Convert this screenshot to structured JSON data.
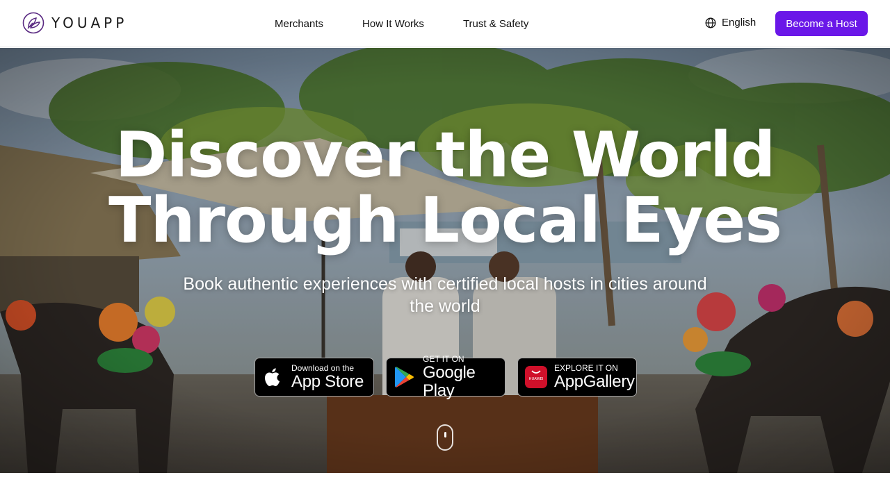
{
  "brand": {
    "name": "YOUAPP",
    "accent": "#6a17e8"
  },
  "nav": {
    "items": [
      {
        "label": "Merchants"
      },
      {
        "label": "How It Works"
      },
      {
        "label": "Trust & Safety"
      }
    ],
    "language": "English",
    "cta": "Become a Host"
  },
  "hero": {
    "line1": "Discover the World",
    "line2": "Through Local Eyes",
    "subtitle": "Book authentic experiences with certified local hosts in cities around the world"
  },
  "stores": {
    "apple": {
      "small": "Download on the",
      "big": "App Store",
      "icon": "apple-icon"
    },
    "google": {
      "small": "GET IT ON",
      "big": "Google Play",
      "icon": "google-play-icon"
    },
    "huawei": {
      "small": "EXPLORE IT ON",
      "big": "AppGallery",
      "icon": "huawei-appgallery-icon",
      "badge": "HUAWEI"
    }
  }
}
